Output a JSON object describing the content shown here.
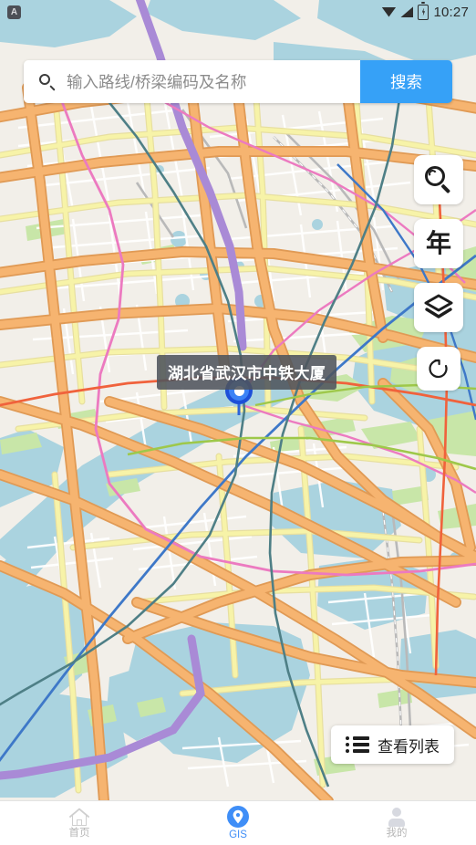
{
  "status_bar": {
    "notification_badge": "A",
    "time": "10:27",
    "icons": [
      "wifi-icon",
      "signal-icon",
      "battery-charging-icon"
    ]
  },
  "search": {
    "placeholder": "输入路线/桥梁编码及名称",
    "value": "",
    "button_label": "搜索",
    "icon": "search-icon",
    "accent_color": "#36a1f7"
  },
  "map_controls": [
    {
      "name": "zoom-search-button",
      "icon": "magnifier-icon",
      "label": ""
    },
    {
      "name": "year-filter-button",
      "icon": "year-icon",
      "label": "年"
    },
    {
      "name": "layers-button",
      "icon": "layers-icon",
      "label": ""
    },
    {
      "name": "refresh-button",
      "icon": "refresh-icon",
      "label": ""
    }
  ],
  "marker": {
    "tooltip_label": "湖北省武汉市中铁大厦",
    "tooltip_bg": "#4e545c",
    "pin_color": "#3b82f6"
  },
  "list_button": {
    "label": "查看列表",
    "icon": "list-icon"
  },
  "bottom_nav": {
    "active": "GIS",
    "items": [
      {
        "label": "首页",
        "icon": "home-icon",
        "active": false
      },
      {
        "label": "GIS",
        "icon": "location-pin-icon",
        "active": true
      },
      {
        "label": "我的",
        "icon": "user-icon",
        "active": false
      }
    ],
    "active_color": "#3f8ef7",
    "inactive_color": "#b6b6b6"
  },
  "map_style": {
    "background": "#f2efe9",
    "water": "#aad3df",
    "motorway": "#f6a868",
    "primary": "#f9d776",
    "secondary": "#f7f3a8",
    "park": "#c8e6a8",
    "rail": "#b5b5b5",
    "metro_purple": "#a98ad6",
    "metro_pink": "#ec7ac0",
    "metro_blue": "#3e78c8",
    "metro_teal": "#4e7f86",
    "metro_orange": "#f0623c",
    "metro_green": "#9ec84a"
  }
}
